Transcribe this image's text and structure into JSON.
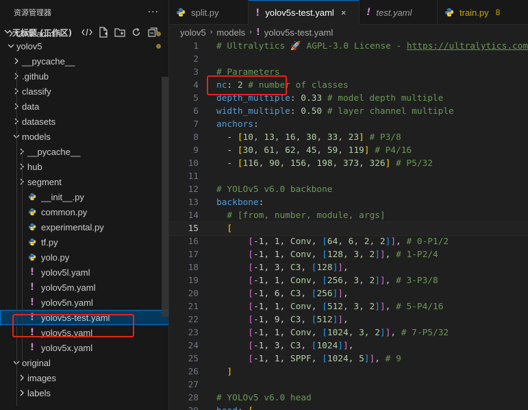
{
  "sidebar": {
    "title": "资源管理器",
    "more": "···",
    "workspace": "无标题 (工作区)",
    "items": [
      {
        "label": "UAV-admin",
        "type": "folder"
      },
      {
        "label": "yolov5",
        "type": "folder-open"
      },
      {
        "label": "__pycache__",
        "type": "folder"
      },
      {
        "label": ".github",
        "type": "folder"
      },
      {
        "label": "classify",
        "type": "folder"
      },
      {
        "label": "data",
        "type": "folder"
      },
      {
        "label": "datasets",
        "type": "folder"
      },
      {
        "label": "models",
        "type": "folder-open"
      },
      {
        "label": "__pycache__",
        "type": "folder"
      },
      {
        "label": "hub",
        "type": "folder"
      },
      {
        "label": "segment",
        "type": "folder"
      },
      {
        "label": "__init__.py",
        "type": "python"
      },
      {
        "label": "common.py",
        "type": "python"
      },
      {
        "label": "experimental.py",
        "type": "python"
      },
      {
        "label": "tf.py",
        "type": "python"
      },
      {
        "label": "yolo.py",
        "type": "python"
      },
      {
        "label": "yolov5l.yaml",
        "type": "yaml"
      },
      {
        "label": "yolov5m.yaml",
        "type": "yaml"
      },
      {
        "label": "yolov5n.yaml",
        "type": "yaml"
      },
      {
        "label": "yolov5s-test.yaml",
        "type": "yaml"
      },
      {
        "label": "yolov5s.yaml",
        "type": "yaml"
      },
      {
        "label": "yolov5x.yaml",
        "type": "yaml"
      },
      {
        "label": "original",
        "type": "folder-open"
      },
      {
        "label": "images",
        "type": "folder"
      },
      {
        "label": "labels",
        "type": "folder"
      }
    ]
  },
  "tabs": [
    {
      "label": "split.py",
      "icon": "python-icon"
    },
    {
      "label": "yolov5s-test.yaml",
      "icon": "yaml-icon",
      "close": "×"
    },
    {
      "label": "test.yaml",
      "icon": "yaml-icon"
    },
    {
      "label": "train.py",
      "icon": "python-icon",
      "badge": "8"
    }
  ],
  "breadcrumb": [
    "yolov5",
    "models",
    "yolov5s-test.yaml"
  ],
  "editor": {
    "current_line": "15",
    "lines": [
      {
        "n": "1"
      },
      {
        "n": "2"
      },
      {
        "n": "3"
      },
      {
        "n": "4"
      },
      {
        "n": "5"
      },
      {
        "n": "6"
      },
      {
        "n": "7"
      },
      {
        "n": "8"
      },
      {
        "n": "9"
      },
      {
        "n": "10"
      },
      {
        "n": "11"
      },
      {
        "n": "12"
      },
      {
        "n": "13"
      },
      {
        "n": "14"
      },
      {
        "n": "15"
      },
      {
        "n": "16"
      },
      {
        "n": "17"
      },
      {
        "n": "18"
      },
      {
        "n": "19"
      },
      {
        "n": "20"
      },
      {
        "n": "21"
      },
      {
        "n": "22"
      },
      {
        "n": "23"
      },
      {
        "n": "24"
      },
      {
        "n": "25"
      },
      {
        "n": "26"
      },
      {
        "n": "27"
      },
      {
        "n": "28"
      },
      {
        "n": "29"
      }
    ],
    "text": {
      "l1": "# Ultralytics 🚀 AGPL-3.0 License - ",
      "l1url": "https://ultralytics.com",
      "l3": "# Parameters",
      "l4k": "nc",
      "l4v": "2",
      "l4c": "# number of classes",
      "l5k": "depth_multiple",
      "l5v": "0.33",
      "l5c": "# model depth multiple",
      "l6k": "width_multiple",
      "l6v": "0.50",
      "l6c": "# layer channel multiple",
      "l7k": "anchors",
      "l8v": "10, 13, 16, 30, 33, 23",
      "l8c": "# P3/8",
      "l9v": "30, 61, 62, 45, 59, 119",
      "l9c": "# P4/16",
      "l10v": "116, 90, 156, 198, 373, 326",
      "l10c": "# P5/32",
      "l12": "# YOLOv5 v6.0 backbone",
      "l13k": "backbone",
      "l14": "# [from, number, module, args]",
      "l16m": "Conv",
      "l16a": "64, 6, 2, 2",
      "l16c": "# 0-P1/2",
      "l17m": "Conv",
      "l17a": "128, 3, 2",
      "l17c": "# 1-P2/4",
      "l18m": "C3",
      "l18a": "128",
      "l19m": "Conv",
      "l19a": "256, 3, 2",
      "l19c": "# 3-P3/8",
      "l20m": "C3",
      "l20a": "256",
      "l21m": "Conv",
      "l21a": "512, 3, 2",
      "l21c": "# 5-P4/16",
      "l22m": "C3",
      "l22a": "512",
      "l23m": "Conv",
      "l23a": "1024, 3, 2",
      "l23c": "# 7-P5/32",
      "l24m": "C3",
      "l24a": "1024",
      "l25m": "SPPF",
      "l25a": "1024, 5",
      "l25c": "# 9",
      "l28": "# YOLOv5 v6.0 head",
      "l29k": "head"
    }
  },
  "colors": {
    "accent": "#0078d4",
    "annotation": "#e8221e",
    "yaml_icon": "#c586c0",
    "python_icon": "#4b8bbe"
  }
}
